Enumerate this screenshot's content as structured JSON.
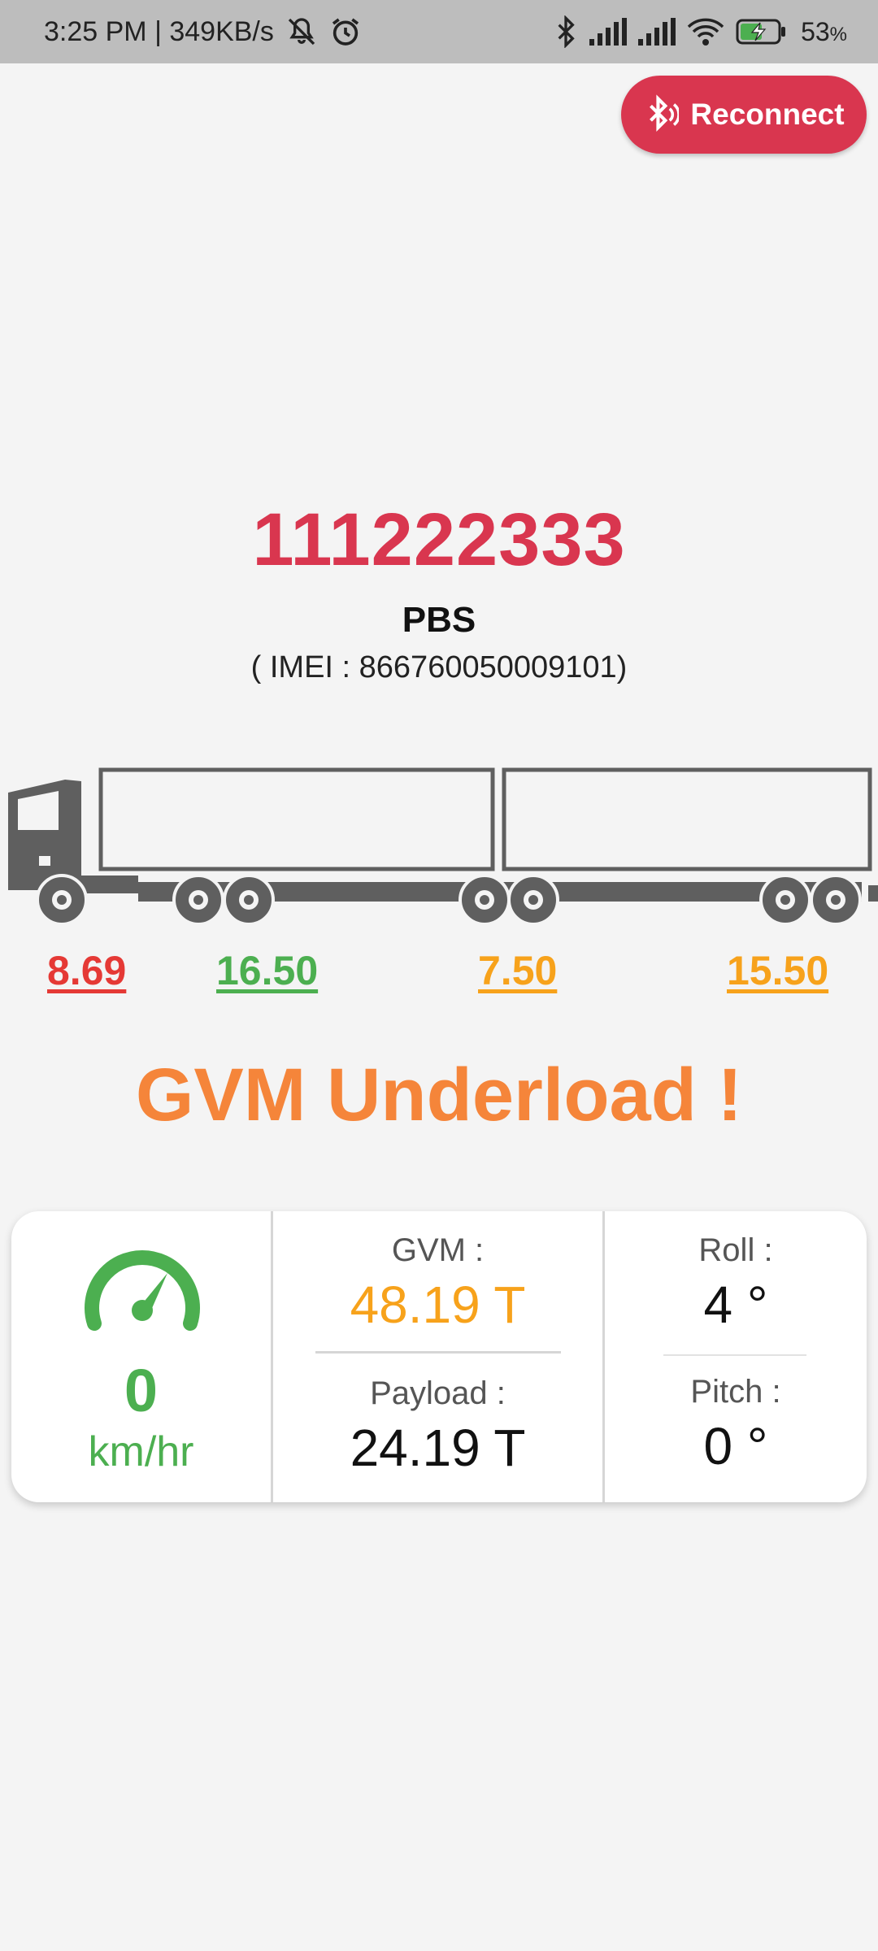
{
  "status_bar": {
    "time_speed": "3:25 PM | 349KB/s",
    "battery_percent": "53",
    "battery_unit": "%",
    "icons": [
      "mute-icon",
      "alarm-icon",
      "bluetooth-icon",
      "signal-icon",
      "signal-icon",
      "wifi-icon",
      "battery-charging-icon"
    ]
  },
  "header": {
    "reconnect_label": "Reconnect",
    "reconnect_icon": "bluetooth-connect-icon",
    "accent": "#d9364f"
  },
  "vehicle": {
    "id": "111222333",
    "type": "PBS",
    "imei": "( IMEI : 866760050009101)"
  },
  "axles": [
    {
      "value": "8.69",
      "color": "#e53935"
    },
    {
      "value": "16.50",
      "color": "#4caf50"
    },
    {
      "value": "7.50",
      "color": "#f7a21b"
    },
    {
      "value": "15.50",
      "color": "#f7a21b"
    }
  ],
  "alert": {
    "text": "GVM Underload !",
    "color": "#f5853a"
  },
  "metrics": {
    "speed_icon": "speedometer-icon",
    "speed_value": "0",
    "speed_unit": "km/hr",
    "gvm_label": "GVM :",
    "gvm_value": "48.19 T",
    "payload_label": "Payload :",
    "payload_value": "24.19 T",
    "roll_label": "Roll :",
    "roll_value": "4 °",
    "pitch_label": "Pitch :",
    "pitch_value": "0 °"
  }
}
